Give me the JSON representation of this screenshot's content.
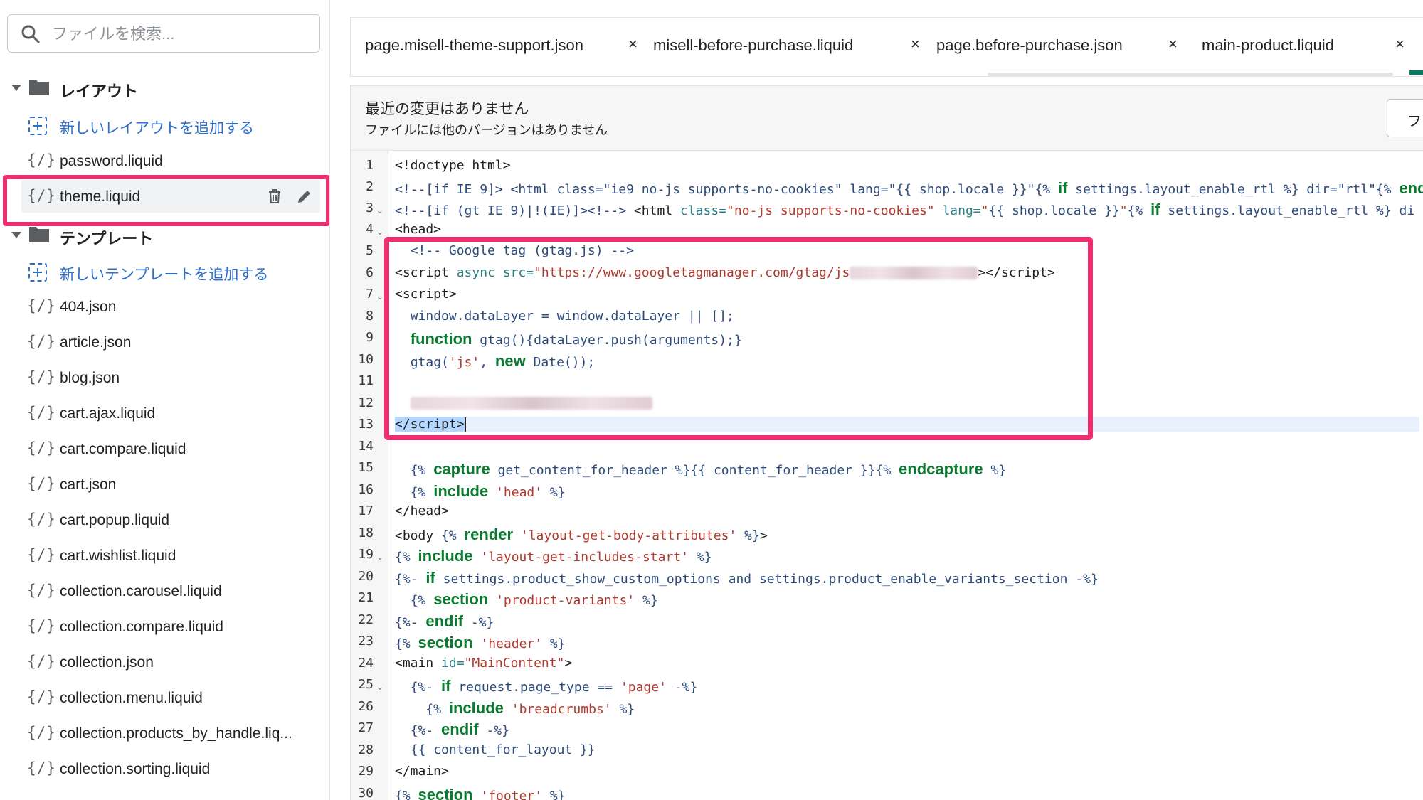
{
  "search": {
    "placeholder": "ファイルを検索..."
  },
  "sidebar": {
    "layout_folder": "レイアウト",
    "add_layout": "新しいレイアウトを追加する",
    "layout_files": [
      "password.liquid",
      "theme.liquid"
    ],
    "template_folder": "テンプレート",
    "add_template": "新しいテンプレートを追加する",
    "template_files": [
      "404.json",
      "article.json",
      "blog.json",
      "cart.ajax.liquid",
      "cart.compare.liquid",
      "cart.json",
      "cart.popup.liquid",
      "cart.wishlist.liquid",
      "collection.carousel.liquid",
      "collection.compare.liquid",
      "collection.json",
      "collection.menu.liquid",
      "collection.products_by_handle.liq...",
      "collection.sorting.liquid"
    ],
    "file_icon": "{/}"
  },
  "tabs": [
    {
      "label": "page.misell-theme-support.json",
      "close": "×"
    },
    {
      "label": "misell-before-purchase.liquid",
      "close": "×"
    },
    {
      "label": "page.before-purchase.json",
      "close": "×"
    },
    {
      "label": "main-product.liquid",
      "close": "×"
    }
  ],
  "version": {
    "title": "最近の変更はありません",
    "subtitle": "ファイルには他のバージョンはありません",
    "button": "フ"
  },
  "editor": {
    "line_numbers": [
      "1",
      "2",
      "3",
      "4",
      "5",
      "6",
      "7",
      "8",
      "9",
      "10",
      "11",
      "12",
      "13",
      "14",
      "15",
      "16",
      "17",
      "18",
      "19",
      "20",
      "21",
      "22",
      "23",
      "24",
      "25",
      "26",
      "27",
      "28",
      "29",
      "30"
    ],
    "active_line": "13"
  },
  "colors": {
    "highlight": "#ee2e6f",
    "link": "#2c6ecb",
    "keyword": "#0a7a2f"
  }
}
